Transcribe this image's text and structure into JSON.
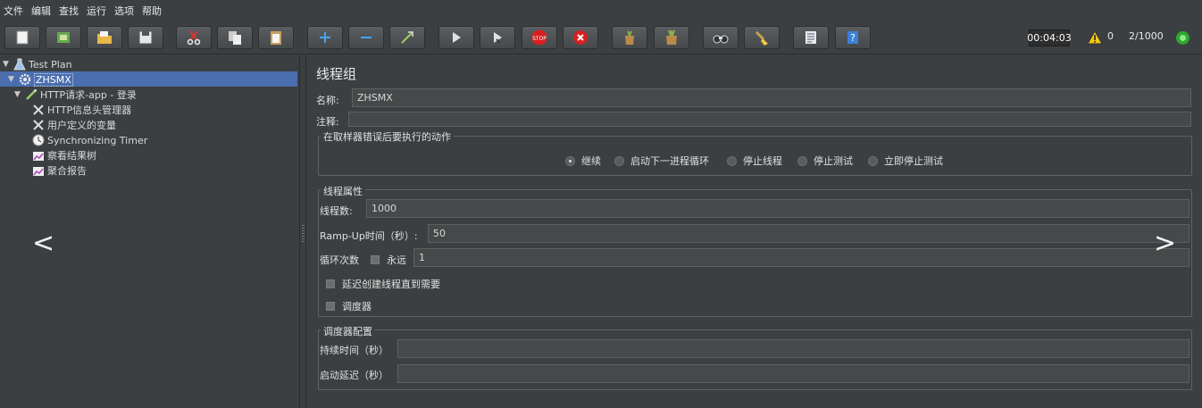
{
  "menu": [
    "文件",
    "编辑",
    "查找",
    "运行",
    "选项",
    "帮助"
  ],
  "toolbar": {
    "icons": [
      "new-icon",
      "templates-icon",
      "open-icon",
      "save-icon",
      "cut-icon",
      "copy-icon",
      "paste-icon",
      "expand-icon",
      "collapse-icon",
      "toggle-icon",
      "start-icon",
      "start-no-pause-icon",
      "stop-icon",
      "shutdown-icon",
      "clear-icon",
      "clear-all-icon",
      "search-icon",
      "reset-search-icon",
      "function-helper-icon",
      "help-icon"
    ],
    "timer": "00:04:03",
    "warnings": "0",
    "threads": "2/1000"
  },
  "tree": {
    "root": "Test Plan",
    "thread_group": "ZHSMX",
    "sampler": "HTTP请求-app - 登录",
    "children": [
      "HTTP信息头管理器",
      "用户定义的变量",
      "Synchronizing Timer",
      "察看结果树",
      "聚合报告"
    ]
  },
  "panel": {
    "title": "线程组",
    "name_label": "名称:",
    "name_value": "ZHSMX",
    "comment_label": "注释:",
    "comment_value": "",
    "error_group_title": "在取样器错误后要执行的动作",
    "error_options": [
      "继续",
      "启动下一进程循环",
      "停止线程",
      "停止测试",
      "立即停止测试"
    ],
    "error_selected": 0,
    "thread_props_title": "线程属性",
    "threads_label": "线程数:",
    "threads_value": "1000",
    "rampup_label": "Ramp-Up时间（秒）:",
    "rampup_value": "50",
    "loop_label": "循环次数",
    "forever_label": "永远",
    "loop_value": "1",
    "delay_label": "延迟创建线程直到需要",
    "scheduler_label": "调度器",
    "scheduler_config_title": "调度器配置",
    "duration_label": "持续时间（秒）",
    "duration_value": "",
    "startup_delay_label": "启动延迟（秒）",
    "startup_delay_value": ""
  },
  "nav": {
    "prev": "<",
    "next": ">"
  }
}
